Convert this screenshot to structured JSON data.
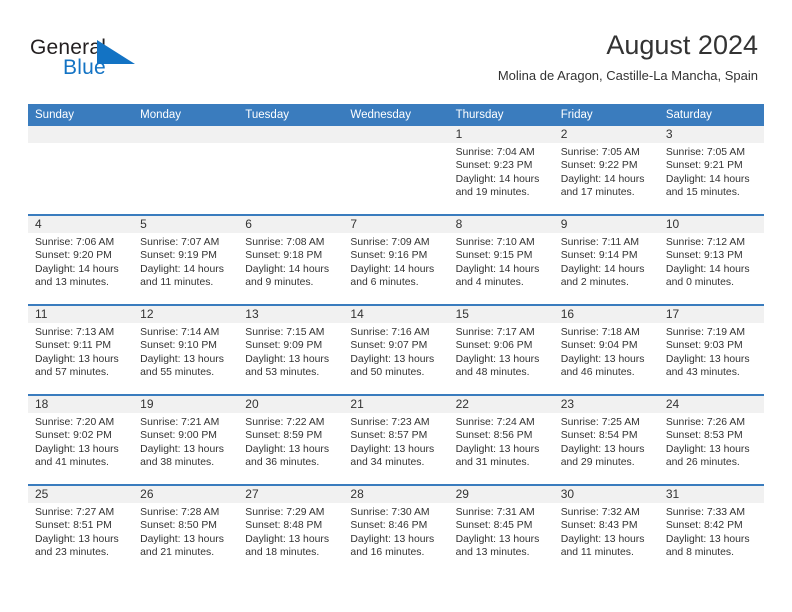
{
  "logo": {
    "word_one": "General",
    "word_two": "Blue",
    "mark": "blue-triangle-icon",
    "colors": {
      "text": "#231f20",
      "accent": "#1373c4"
    }
  },
  "header": {
    "title": "August 2024",
    "location": "Molina de Aragon, Castille-La Mancha, Spain"
  },
  "theme": {
    "header_bar": "#3a7cbe",
    "row_divider": "#3a7cbe",
    "day_band": "#f1f1f1",
    "text": "#333333"
  },
  "calendar": {
    "weekdays": [
      "Sunday",
      "Monday",
      "Tuesday",
      "Wednesday",
      "Thursday",
      "Friday",
      "Saturday"
    ],
    "weeks": [
      [
        {
          "day": "",
          "empty": true
        },
        {
          "day": "",
          "empty": true
        },
        {
          "day": "",
          "empty": true
        },
        {
          "day": "",
          "empty": true
        },
        {
          "day": "1",
          "sunrise": "Sunrise: 7:04 AM",
          "sunset": "Sunset: 9:23 PM",
          "daylight": "Daylight: 14 hours and 19 minutes."
        },
        {
          "day": "2",
          "sunrise": "Sunrise: 7:05 AM",
          "sunset": "Sunset: 9:22 PM",
          "daylight": "Daylight: 14 hours and 17 minutes."
        },
        {
          "day": "3",
          "sunrise": "Sunrise: 7:05 AM",
          "sunset": "Sunset: 9:21 PM",
          "daylight": "Daylight: 14 hours and 15 minutes."
        }
      ],
      [
        {
          "day": "4",
          "sunrise": "Sunrise: 7:06 AM",
          "sunset": "Sunset: 9:20 PM",
          "daylight": "Daylight: 14 hours and 13 minutes."
        },
        {
          "day": "5",
          "sunrise": "Sunrise: 7:07 AM",
          "sunset": "Sunset: 9:19 PM",
          "daylight": "Daylight: 14 hours and 11 minutes."
        },
        {
          "day": "6",
          "sunrise": "Sunrise: 7:08 AM",
          "sunset": "Sunset: 9:18 PM",
          "daylight": "Daylight: 14 hours and 9 minutes."
        },
        {
          "day": "7",
          "sunrise": "Sunrise: 7:09 AM",
          "sunset": "Sunset: 9:16 PM",
          "daylight": "Daylight: 14 hours and 6 minutes."
        },
        {
          "day": "8",
          "sunrise": "Sunrise: 7:10 AM",
          "sunset": "Sunset: 9:15 PM",
          "daylight": "Daylight: 14 hours and 4 minutes."
        },
        {
          "day": "9",
          "sunrise": "Sunrise: 7:11 AM",
          "sunset": "Sunset: 9:14 PM",
          "daylight": "Daylight: 14 hours and 2 minutes."
        },
        {
          "day": "10",
          "sunrise": "Sunrise: 7:12 AM",
          "sunset": "Sunset: 9:13 PM",
          "daylight": "Daylight: 14 hours and 0 minutes."
        }
      ],
      [
        {
          "day": "11",
          "sunrise": "Sunrise: 7:13 AM",
          "sunset": "Sunset: 9:11 PM",
          "daylight": "Daylight: 13 hours and 57 minutes."
        },
        {
          "day": "12",
          "sunrise": "Sunrise: 7:14 AM",
          "sunset": "Sunset: 9:10 PM",
          "daylight": "Daylight: 13 hours and 55 minutes."
        },
        {
          "day": "13",
          "sunrise": "Sunrise: 7:15 AM",
          "sunset": "Sunset: 9:09 PM",
          "daylight": "Daylight: 13 hours and 53 minutes."
        },
        {
          "day": "14",
          "sunrise": "Sunrise: 7:16 AM",
          "sunset": "Sunset: 9:07 PM",
          "daylight": "Daylight: 13 hours and 50 minutes."
        },
        {
          "day": "15",
          "sunrise": "Sunrise: 7:17 AM",
          "sunset": "Sunset: 9:06 PM",
          "daylight": "Daylight: 13 hours and 48 minutes."
        },
        {
          "day": "16",
          "sunrise": "Sunrise: 7:18 AM",
          "sunset": "Sunset: 9:04 PM",
          "daylight": "Daylight: 13 hours and 46 minutes."
        },
        {
          "day": "17",
          "sunrise": "Sunrise: 7:19 AM",
          "sunset": "Sunset: 9:03 PM",
          "daylight": "Daylight: 13 hours and 43 minutes."
        }
      ],
      [
        {
          "day": "18",
          "sunrise": "Sunrise: 7:20 AM",
          "sunset": "Sunset: 9:02 PM",
          "daylight": "Daylight: 13 hours and 41 minutes."
        },
        {
          "day": "19",
          "sunrise": "Sunrise: 7:21 AM",
          "sunset": "Sunset: 9:00 PM",
          "daylight": "Daylight: 13 hours and 38 minutes."
        },
        {
          "day": "20",
          "sunrise": "Sunrise: 7:22 AM",
          "sunset": "Sunset: 8:59 PM",
          "daylight": "Daylight: 13 hours and 36 minutes."
        },
        {
          "day": "21",
          "sunrise": "Sunrise: 7:23 AM",
          "sunset": "Sunset: 8:57 PM",
          "daylight": "Daylight: 13 hours and 34 minutes."
        },
        {
          "day": "22",
          "sunrise": "Sunrise: 7:24 AM",
          "sunset": "Sunset: 8:56 PM",
          "daylight": "Daylight: 13 hours and 31 minutes."
        },
        {
          "day": "23",
          "sunrise": "Sunrise: 7:25 AM",
          "sunset": "Sunset: 8:54 PM",
          "daylight": "Daylight: 13 hours and 29 minutes."
        },
        {
          "day": "24",
          "sunrise": "Sunrise: 7:26 AM",
          "sunset": "Sunset: 8:53 PM",
          "daylight": "Daylight: 13 hours and 26 minutes."
        }
      ],
      [
        {
          "day": "25",
          "sunrise": "Sunrise: 7:27 AM",
          "sunset": "Sunset: 8:51 PM",
          "daylight": "Daylight: 13 hours and 23 minutes."
        },
        {
          "day": "26",
          "sunrise": "Sunrise: 7:28 AM",
          "sunset": "Sunset: 8:50 PM",
          "daylight": "Daylight: 13 hours and 21 minutes."
        },
        {
          "day": "27",
          "sunrise": "Sunrise: 7:29 AM",
          "sunset": "Sunset: 8:48 PM",
          "daylight": "Daylight: 13 hours and 18 minutes."
        },
        {
          "day": "28",
          "sunrise": "Sunrise: 7:30 AM",
          "sunset": "Sunset: 8:46 PM",
          "daylight": "Daylight: 13 hours and 16 minutes."
        },
        {
          "day": "29",
          "sunrise": "Sunrise: 7:31 AM",
          "sunset": "Sunset: 8:45 PM",
          "daylight": "Daylight: 13 hours and 13 minutes."
        },
        {
          "day": "30",
          "sunrise": "Sunrise: 7:32 AM",
          "sunset": "Sunset: 8:43 PM",
          "daylight": "Daylight: 13 hours and 11 minutes."
        },
        {
          "day": "31",
          "sunrise": "Sunrise: 7:33 AM",
          "sunset": "Sunset: 8:42 PM",
          "daylight": "Daylight: 13 hours and 8 minutes."
        }
      ]
    ]
  }
}
